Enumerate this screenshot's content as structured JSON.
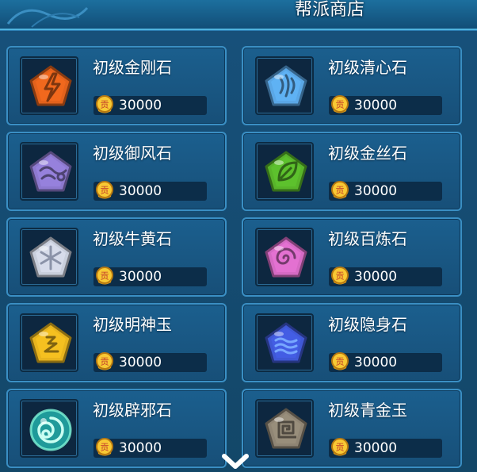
{
  "header": {
    "title": "帮派商店"
  },
  "currency": {
    "symbol": "贡"
  },
  "items": [
    {
      "name": "初级金刚石",
      "price": "30000",
      "icon": "orange-lightning-gem-icon",
      "color": "#e3621c",
      "glyph": "bolt"
    },
    {
      "name": "初级清心石",
      "price": "30000",
      "icon": "blue-wave-gem-icon",
      "color": "#5aa7e6",
      "glyph": "waves"
    },
    {
      "name": "初级御风石",
      "price": "30000",
      "icon": "purple-wind-gem-icon",
      "color": "#8d79cf",
      "glyph": "wind"
    },
    {
      "name": "初级金丝石",
      "price": "30000",
      "icon": "green-leaf-gem-icon",
      "color": "#58b52a",
      "glyph": "leaf"
    },
    {
      "name": "初级牛黄石",
      "price": "30000",
      "icon": "white-star-gem-icon",
      "color": "#c9cfdc",
      "glyph": "asterisk"
    },
    {
      "name": "初级百炼石",
      "price": "30000",
      "icon": "pink-spiral-gem-icon",
      "color": "#d56ac4",
      "glyph": "spiral"
    },
    {
      "name": "初级明神玉",
      "price": "30000",
      "icon": "yellow-rune-gem-icon",
      "color": "#e8b41e",
      "glyph": "rune"
    },
    {
      "name": "初级隐身石",
      "price": "30000",
      "icon": "blue-water-gem-icon",
      "color": "#3f58d6",
      "glyph": "water"
    },
    {
      "name": "初级辟邪石",
      "price": "30000",
      "icon": "green-swirl-orb-icon",
      "color": "#2fc39a",
      "glyph": "orb"
    },
    {
      "name": "初级青金玉",
      "price": "30000",
      "icon": "grey-maze-gem-icon",
      "color": "#8f8574",
      "glyph": "maze"
    }
  ]
}
